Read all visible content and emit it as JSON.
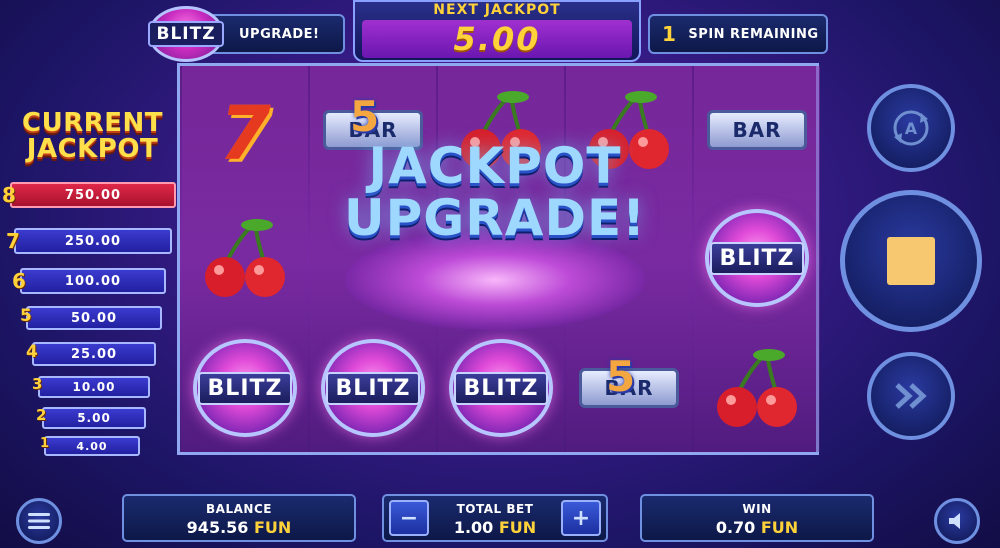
{
  "header": {
    "logo_text": "BLITZ",
    "upgrade_label": "UPGRADE!",
    "next_jackpot_label": "NEXT JACKPOT",
    "next_jackpot_value": "5.00",
    "spins_count": "1",
    "spins_label": "SPIN REMAINING"
  },
  "banner": {
    "line1": "JACKPOT",
    "line2": "UPGRADE!"
  },
  "symbols": {
    "blitz": "BLITZ",
    "bar": "BAR",
    "five": "5",
    "seven": "7"
  },
  "current_jackpot": {
    "title_line1": "CURRENT",
    "title_line2": "JACKPOT",
    "levels": [
      {
        "num": "8",
        "value": "750.00"
      },
      {
        "num": "7",
        "value": "250.00"
      },
      {
        "num": "6",
        "value": "100.00"
      },
      {
        "num": "5",
        "value": "50.00"
      },
      {
        "num": "4",
        "value": "25.00"
      },
      {
        "num": "3",
        "value": "10.00"
      },
      {
        "num": "2",
        "value": "5.00"
      },
      {
        "num": "1",
        "value": "4.00"
      }
    ]
  },
  "footer": {
    "balance_label": "BALANCE",
    "balance_value": "945.56",
    "currency": "FUN",
    "bet_label": "TOTAL BET",
    "bet_value": "1.00",
    "win_label": "WIN",
    "win_value": "0.70",
    "minus": "−",
    "plus": "+"
  },
  "colors": {
    "accent_gold": "#ffd23a",
    "panel_border": "#6f8fe0",
    "active_jackpot": "#e0284a"
  }
}
